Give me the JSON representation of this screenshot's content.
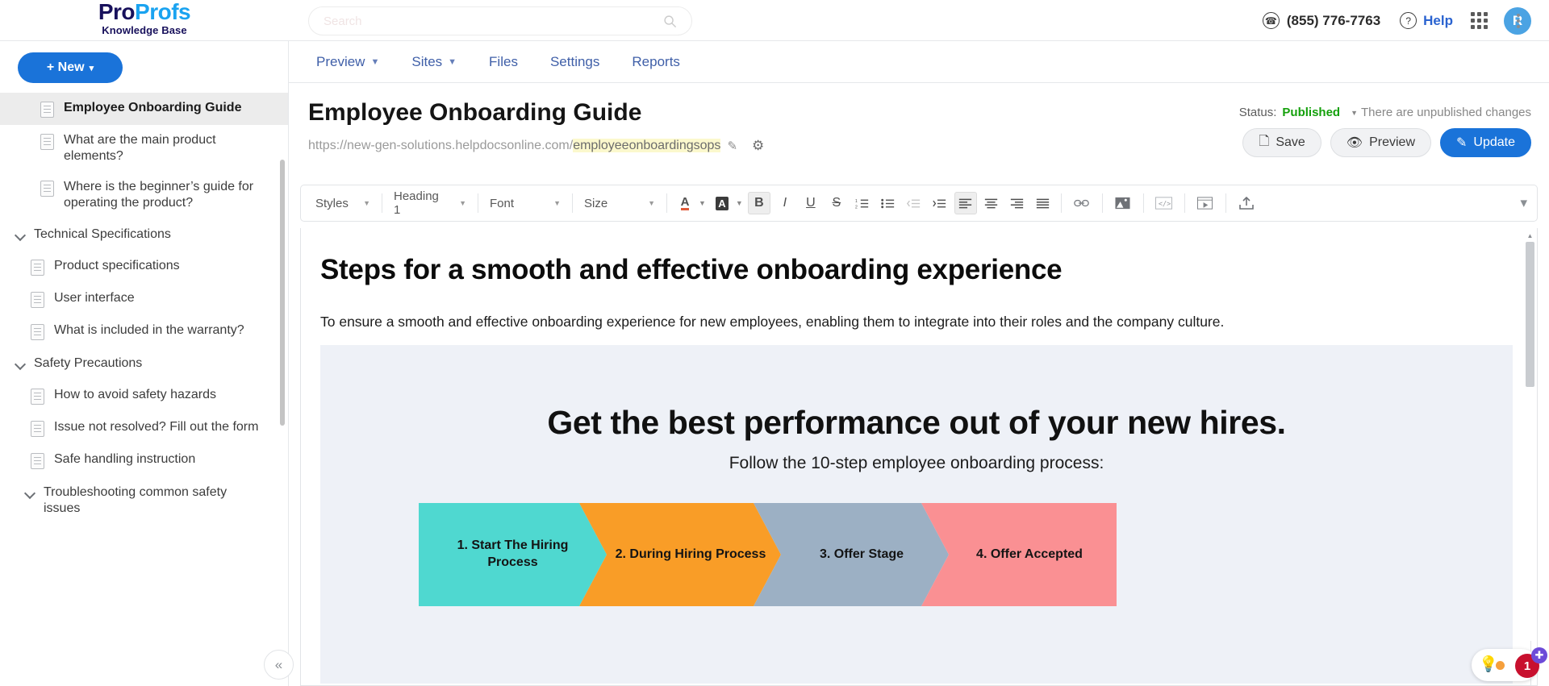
{
  "brand": {
    "name_part1": "Pro",
    "name_part2": "Profs",
    "product": "Knowledge Base"
  },
  "search": {
    "placeholder": "Search",
    "value": "",
    "icon": "search-icon"
  },
  "topbar": {
    "phone": "(855) 776-7763",
    "phone_icon": "phone-icon",
    "help_label": "Help",
    "help_icon": "question-circle-icon",
    "apps_icon": "apps-grid-icon",
    "avatar_initial": "R"
  },
  "sidebar": {
    "new_button": "+ New",
    "tree": [
      {
        "type": "doc",
        "label": "Employee Onboarding Guide",
        "selected": true,
        "level": 0
      },
      {
        "type": "doc",
        "label": "What are the main product elements?",
        "selected": false,
        "level": 0
      },
      {
        "type": "doc",
        "label": "Where is the beginner’s guide for operating the product?",
        "selected": false,
        "level": 0
      },
      {
        "type": "group",
        "label": "Technical Specifications",
        "expanded": true,
        "level": 0
      },
      {
        "type": "doc",
        "label": "Product specifications",
        "selected": false,
        "level": 1
      },
      {
        "type": "doc",
        "label": "User interface",
        "selected": false,
        "level": 1
      },
      {
        "type": "doc",
        "label": "What is included in the warranty?",
        "selected": false,
        "level": 1
      },
      {
        "type": "group",
        "label": "Safety Precautions",
        "expanded": true,
        "level": 0
      },
      {
        "type": "doc",
        "label": "How to avoid safety hazards",
        "selected": false,
        "level": 1
      },
      {
        "type": "doc",
        "label": "Issue not resolved? Fill out the form",
        "selected": false,
        "level": 1
      },
      {
        "type": "doc",
        "label": "Safe handling instruction",
        "selected": false,
        "level": 1
      },
      {
        "type": "group",
        "label": "Troubleshooting common safety issues",
        "expanded": true,
        "level": 1
      }
    ],
    "collapse_icon": "«"
  },
  "mainnav": {
    "items": [
      {
        "label": "Preview",
        "has_caret": true
      },
      {
        "label": "Sites",
        "has_caret": true
      },
      {
        "label": "Files",
        "has_caret": false
      },
      {
        "label": "Settings",
        "has_caret": false
      },
      {
        "label": "Reports",
        "has_caret": false
      }
    ],
    "overflow_icon": "kebab-menu-icon"
  },
  "document_header": {
    "title": "Employee Onboarding Guide",
    "url_base": "https://new-gen-solutions.helpdocsonline.com/",
    "url_slug": "employeeonboardingsops",
    "edit_icon": "pencil-icon",
    "settings_icon": "gear-icon",
    "status_label": "Status:",
    "status_value": "Published",
    "status_color": "#14a00b",
    "unpublished_note": "There are unpublished changes",
    "buttons": {
      "save": "Save",
      "preview": "Preview",
      "update": "Update"
    }
  },
  "toolbar": {
    "styles_label": "Styles",
    "heading_label": "Heading 1",
    "font_label": "Font",
    "size_label": "Size",
    "buttons": [
      {
        "name": "text-color-icon",
        "glyph": "A",
        "kind": "color"
      },
      {
        "name": "highlight-color-icon",
        "glyph": "A",
        "kind": "highlight"
      },
      {
        "name": "bold-icon",
        "glyph": "B",
        "active": true
      },
      {
        "name": "italic-icon",
        "glyph": "I"
      },
      {
        "name": "underline-icon",
        "glyph": "U"
      },
      {
        "name": "strikethrough-icon",
        "glyph": "S"
      },
      {
        "name": "numbered-list-icon",
        "glyph": "≡"
      },
      {
        "name": "bulleted-list-icon",
        "glyph": "≔"
      },
      {
        "name": "decrease-indent-icon",
        "glyph": "⇤",
        "disabled": true
      },
      {
        "name": "increase-indent-icon",
        "glyph": "⇥"
      },
      {
        "name": "align-left-icon",
        "glyph": "≡",
        "active": true
      },
      {
        "name": "align-center-icon",
        "glyph": "≡"
      },
      {
        "name": "align-right-icon",
        "glyph": "≡"
      },
      {
        "name": "justify-icon",
        "glyph": "≡"
      },
      {
        "name": "insert-link-icon",
        "glyph": "🔗"
      },
      {
        "name": "insert-image-icon",
        "glyph": "🖼"
      },
      {
        "name": "source-code-icon",
        "glyph": "</>"
      },
      {
        "name": "insert-video-icon",
        "glyph": "▶"
      },
      {
        "name": "upload-icon",
        "glyph": "⬆"
      }
    ],
    "collapse_icon": "chevron-down-icon"
  },
  "content": {
    "heading": "Steps for a smooth and effective onboarding experience",
    "paragraph": "To ensure a smooth and effective onboarding experience for new employees, enabling them to integrate into their roles and the company culture.",
    "infographic": {
      "headline": "Get the best performance out of your new hires.",
      "subhead": "Follow the 10-step employee onboarding process:",
      "background": "#eef1f7",
      "steps": [
        {
          "label": "1. Start The Hiring Process",
          "color": "#4fd8d0"
        },
        {
          "label": "2. During Hiring Process",
          "color": "#f99d27"
        },
        {
          "label": "3. Offer Stage",
          "color": "#9cb0c4"
        },
        {
          "label": "4. Offer Accepted",
          "color": "#fa9093"
        }
      ]
    }
  },
  "floating_widget": {
    "bulb_icon": "lightbulb-icon",
    "badge_count": "1",
    "plus_icon": "plus-icon"
  }
}
